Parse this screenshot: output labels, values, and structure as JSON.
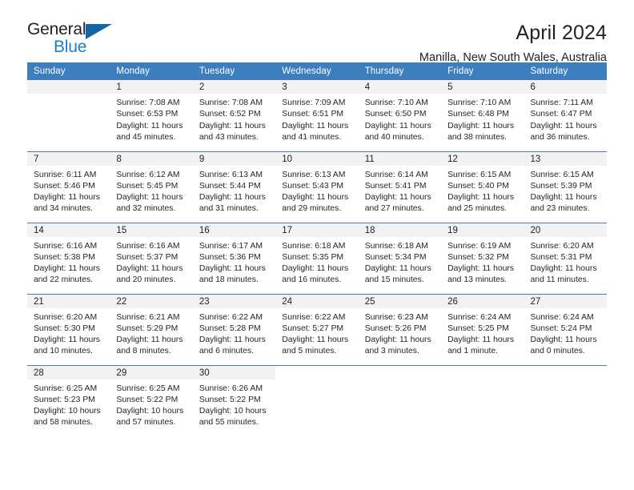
{
  "brand": {
    "name_line1": "General",
    "name_line2": "Blue",
    "triangle_color": "#1465a8",
    "blue_color": "#1b7fc4"
  },
  "header": {
    "title": "April 2024",
    "subtitle": "Manilla, New South Wales, Australia",
    "accent_color": "#3d7ebe",
    "daynum_bg": "#f2f2f2"
  },
  "weekdays": [
    "Sunday",
    "Monday",
    "Tuesday",
    "Wednesday",
    "Thursday",
    "Friday",
    "Saturday"
  ],
  "weeks": [
    [
      {
        "day": "",
        "sunrise": "",
        "sunset": "",
        "daylight1": "",
        "daylight2": ""
      },
      {
        "day": "1",
        "sunrise": "Sunrise: 7:08 AM",
        "sunset": "Sunset: 6:53 PM",
        "daylight1": "Daylight: 11 hours",
        "daylight2": "and 45 minutes."
      },
      {
        "day": "2",
        "sunrise": "Sunrise: 7:08 AM",
        "sunset": "Sunset: 6:52 PM",
        "daylight1": "Daylight: 11 hours",
        "daylight2": "and 43 minutes."
      },
      {
        "day": "3",
        "sunrise": "Sunrise: 7:09 AM",
        "sunset": "Sunset: 6:51 PM",
        "daylight1": "Daylight: 11 hours",
        "daylight2": "and 41 minutes."
      },
      {
        "day": "4",
        "sunrise": "Sunrise: 7:10 AM",
        "sunset": "Sunset: 6:50 PM",
        "daylight1": "Daylight: 11 hours",
        "daylight2": "and 40 minutes."
      },
      {
        "day": "5",
        "sunrise": "Sunrise: 7:10 AM",
        "sunset": "Sunset: 6:48 PM",
        "daylight1": "Daylight: 11 hours",
        "daylight2": "and 38 minutes."
      },
      {
        "day": "6",
        "sunrise": "Sunrise: 7:11 AM",
        "sunset": "Sunset: 6:47 PM",
        "daylight1": "Daylight: 11 hours",
        "daylight2": "and 36 minutes."
      }
    ],
    [
      {
        "day": "7",
        "sunrise": "Sunrise: 6:11 AM",
        "sunset": "Sunset: 5:46 PM",
        "daylight1": "Daylight: 11 hours",
        "daylight2": "and 34 minutes."
      },
      {
        "day": "8",
        "sunrise": "Sunrise: 6:12 AM",
        "sunset": "Sunset: 5:45 PM",
        "daylight1": "Daylight: 11 hours",
        "daylight2": "and 32 minutes."
      },
      {
        "day": "9",
        "sunrise": "Sunrise: 6:13 AM",
        "sunset": "Sunset: 5:44 PM",
        "daylight1": "Daylight: 11 hours",
        "daylight2": "and 31 minutes."
      },
      {
        "day": "10",
        "sunrise": "Sunrise: 6:13 AM",
        "sunset": "Sunset: 5:43 PM",
        "daylight1": "Daylight: 11 hours",
        "daylight2": "and 29 minutes."
      },
      {
        "day": "11",
        "sunrise": "Sunrise: 6:14 AM",
        "sunset": "Sunset: 5:41 PM",
        "daylight1": "Daylight: 11 hours",
        "daylight2": "and 27 minutes."
      },
      {
        "day": "12",
        "sunrise": "Sunrise: 6:15 AM",
        "sunset": "Sunset: 5:40 PM",
        "daylight1": "Daylight: 11 hours",
        "daylight2": "and 25 minutes."
      },
      {
        "day": "13",
        "sunrise": "Sunrise: 6:15 AM",
        "sunset": "Sunset: 5:39 PM",
        "daylight1": "Daylight: 11 hours",
        "daylight2": "and 23 minutes."
      }
    ],
    [
      {
        "day": "14",
        "sunrise": "Sunrise: 6:16 AM",
        "sunset": "Sunset: 5:38 PM",
        "daylight1": "Daylight: 11 hours",
        "daylight2": "and 22 minutes."
      },
      {
        "day": "15",
        "sunrise": "Sunrise: 6:16 AM",
        "sunset": "Sunset: 5:37 PM",
        "daylight1": "Daylight: 11 hours",
        "daylight2": "and 20 minutes."
      },
      {
        "day": "16",
        "sunrise": "Sunrise: 6:17 AM",
        "sunset": "Sunset: 5:36 PM",
        "daylight1": "Daylight: 11 hours",
        "daylight2": "and 18 minutes."
      },
      {
        "day": "17",
        "sunrise": "Sunrise: 6:18 AM",
        "sunset": "Sunset: 5:35 PM",
        "daylight1": "Daylight: 11 hours",
        "daylight2": "and 16 minutes."
      },
      {
        "day": "18",
        "sunrise": "Sunrise: 6:18 AM",
        "sunset": "Sunset: 5:34 PM",
        "daylight1": "Daylight: 11 hours",
        "daylight2": "and 15 minutes."
      },
      {
        "day": "19",
        "sunrise": "Sunrise: 6:19 AM",
        "sunset": "Sunset: 5:32 PM",
        "daylight1": "Daylight: 11 hours",
        "daylight2": "and 13 minutes."
      },
      {
        "day": "20",
        "sunrise": "Sunrise: 6:20 AM",
        "sunset": "Sunset: 5:31 PM",
        "daylight1": "Daylight: 11 hours",
        "daylight2": "and 11 minutes."
      }
    ],
    [
      {
        "day": "21",
        "sunrise": "Sunrise: 6:20 AM",
        "sunset": "Sunset: 5:30 PM",
        "daylight1": "Daylight: 11 hours",
        "daylight2": "and 10 minutes."
      },
      {
        "day": "22",
        "sunrise": "Sunrise: 6:21 AM",
        "sunset": "Sunset: 5:29 PM",
        "daylight1": "Daylight: 11 hours",
        "daylight2": "and 8 minutes."
      },
      {
        "day": "23",
        "sunrise": "Sunrise: 6:22 AM",
        "sunset": "Sunset: 5:28 PM",
        "daylight1": "Daylight: 11 hours",
        "daylight2": "and 6 minutes."
      },
      {
        "day": "24",
        "sunrise": "Sunrise: 6:22 AM",
        "sunset": "Sunset: 5:27 PM",
        "daylight1": "Daylight: 11 hours",
        "daylight2": "and 5 minutes."
      },
      {
        "day": "25",
        "sunrise": "Sunrise: 6:23 AM",
        "sunset": "Sunset: 5:26 PM",
        "daylight1": "Daylight: 11 hours",
        "daylight2": "and 3 minutes."
      },
      {
        "day": "26",
        "sunrise": "Sunrise: 6:24 AM",
        "sunset": "Sunset: 5:25 PM",
        "daylight1": "Daylight: 11 hours",
        "daylight2": "and 1 minute."
      },
      {
        "day": "27",
        "sunrise": "Sunrise: 6:24 AM",
        "sunset": "Sunset: 5:24 PM",
        "daylight1": "Daylight: 11 hours",
        "daylight2": "and 0 minutes."
      }
    ],
    [
      {
        "day": "28",
        "sunrise": "Sunrise: 6:25 AM",
        "sunset": "Sunset: 5:23 PM",
        "daylight1": "Daylight: 10 hours",
        "daylight2": "and 58 minutes."
      },
      {
        "day": "29",
        "sunrise": "Sunrise: 6:25 AM",
        "sunset": "Sunset: 5:22 PM",
        "daylight1": "Daylight: 10 hours",
        "daylight2": "and 57 minutes."
      },
      {
        "day": "30",
        "sunrise": "Sunrise: 6:26 AM",
        "sunset": "Sunset: 5:22 PM",
        "daylight1": "Daylight: 10 hours",
        "daylight2": "and 55 minutes."
      },
      {
        "day": "",
        "sunrise": "",
        "sunset": "",
        "daylight1": "",
        "daylight2": ""
      },
      {
        "day": "",
        "sunrise": "",
        "sunset": "",
        "daylight1": "",
        "daylight2": ""
      },
      {
        "day": "",
        "sunrise": "",
        "sunset": "",
        "daylight1": "",
        "daylight2": ""
      },
      {
        "day": "",
        "sunrise": "",
        "sunset": "",
        "daylight1": "",
        "daylight2": ""
      }
    ]
  ]
}
